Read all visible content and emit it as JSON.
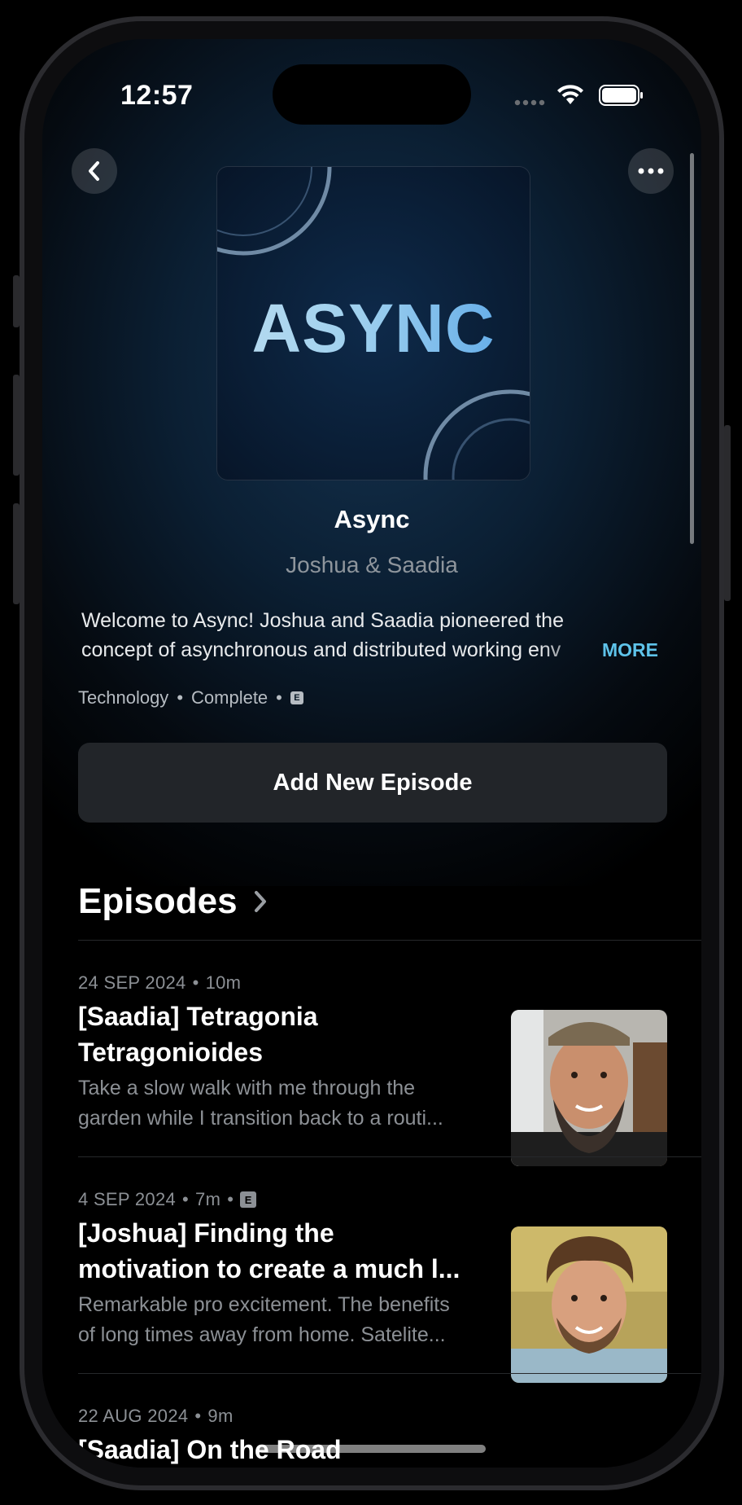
{
  "status_bar": {
    "time": "12:57",
    "icons": [
      "signal-icon",
      "wifi-icon",
      "battery-icon"
    ]
  },
  "nav": {
    "back_icon": "chevron-left-icon",
    "more_icon": "ellipsis-icon"
  },
  "podcast": {
    "artwork_text": "ASYNC",
    "title": "Async",
    "author": "Joshua & Saadia",
    "description_line1": "Welcome to Async! Joshua and Saadia pioneered the",
    "description_line2": "concept of asynchronous and distributed working env",
    "more_label": "MORE",
    "category": "Technology",
    "status": "Complete",
    "explicit_badge": "E"
  },
  "actions": {
    "add_episode_label": "Add New Episode"
  },
  "episodes_section": {
    "heading": "Episodes",
    "items": [
      {
        "date": "24 SEP 2024",
        "duration": "10m",
        "explicit": "",
        "title_line1": "[Saadia] Tetragonia",
        "title_line2": "Tetragonioides",
        "desc_line1": "Take a slow walk with me through the",
        "desc_line2": "garden while I transition back to a routi..."
      },
      {
        "date": "4 SEP 2024",
        "duration": "7m",
        "explicit": "E",
        "title_line1": "[Joshua] Finding the",
        "title_line2": "motivation to create a much l...",
        "desc_line1": "Remarkable pro excitement. The benefits",
        "desc_line2": "of long times away from home. Satelite..."
      },
      {
        "date": "22 AUG 2024",
        "duration": "9m",
        "explicit": "",
        "title_line1": "[Saadia] On the Road",
        "title_line2": "",
        "desc_line1": "",
        "desc_line2": ""
      }
    ]
  },
  "colors": {
    "accent": "#5ec3ea",
    "background": "#000000",
    "button_bg": "#222529"
  }
}
